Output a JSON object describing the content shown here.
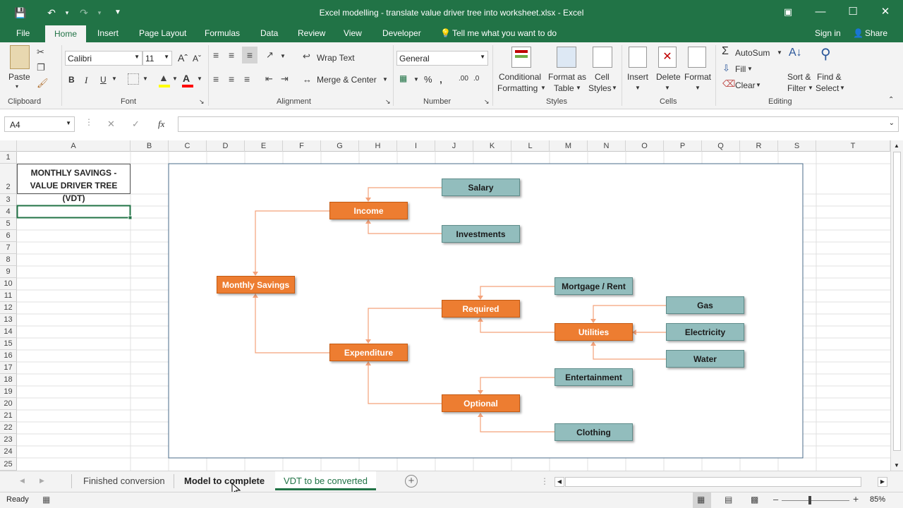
{
  "window": {
    "title": "Excel modelling - translate value driver tree into worksheet.xlsx - Excel",
    "restore_icon": "restore-window-icon"
  },
  "tabs": [
    {
      "label": "File"
    },
    {
      "label": "Home"
    },
    {
      "label": "Insert"
    },
    {
      "label": "Page Layout"
    },
    {
      "label": "Formulas"
    },
    {
      "label": "Data"
    },
    {
      "label": "Review"
    },
    {
      "label": "View"
    },
    {
      "label": "Developer"
    }
  ],
  "tell_me": "Tell me what you want to do",
  "sign_in": "Sign in",
  "share": "Share",
  "ribbon": {
    "clipboard": {
      "paste": "Paste",
      "label": "Clipboard"
    },
    "font": {
      "name": "Calibri",
      "size": "11",
      "label": "Font",
      "bold": "B",
      "italic": "I",
      "underline": "U"
    },
    "alignment": {
      "wrap": "Wrap Text",
      "merge": "Merge & Center",
      "label": "Alignment"
    },
    "number": {
      "format": "General",
      "label": "Number",
      "percent": "%"
    },
    "styles": {
      "conditional1": "Conditional",
      "conditional2": "Formatting",
      "format_as1": "Format as",
      "format_as2": "Table",
      "cell1": "Cell",
      "cell2": "Styles",
      "label": "Styles"
    },
    "cells": {
      "insert": "Insert",
      "delete": "Delete",
      "format": "Format",
      "label": "Cells"
    },
    "editing": {
      "autosum": "AutoSum",
      "fill": "Fill",
      "clear": "Clear",
      "sort1": "Sort &",
      "sort2": "Filter",
      "find1": "Find &",
      "find2": "Select",
      "label": "Editing"
    }
  },
  "formula_bar": {
    "name_box": "A4",
    "fx": "fx",
    "value": ""
  },
  "columns": [
    "A",
    "B",
    "C",
    "D",
    "E",
    "F",
    "G",
    "H",
    "I",
    "J",
    "K",
    "L",
    "M",
    "N",
    "O",
    "P",
    "Q",
    "R",
    "S",
    "T"
  ],
  "rows": [
    "1",
    "2",
    "3",
    "4",
    "5",
    "6",
    "7",
    "8",
    "9",
    "10",
    "11",
    "12",
    "13",
    "14",
    "15",
    "16",
    "17",
    "18",
    "19",
    "20",
    "21",
    "22",
    "23",
    "24",
    "25"
  ],
  "cells": {
    "a2_line1": "MONTHLY SAVINGS -",
    "a2_line2": "VALUE DRIVER TREE (VDT)"
  },
  "vdt": {
    "salary": "Salary",
    "income": "Income",
    "investments": "Investments",
    "monthly_savings": "Monthly Savings",
    "mortgage": "Mortgage / Rent",
    "required": "Required",
    "gas": "Gas",
    "utilities": "Utilities",
    "electricity": "Electricity",
    "water": "Water",
    "expenditure": "Expenditure",
    "entertainment": "Entertainment",
    "optional": "Optional",
    "clothing": "Clothing",
    "colors": {
      "orange": "#ED7D31",
      "teal": "#92BDBD",
      "connector": "#F4A27A"
    }
  },
  "sheets": [
    {
      "label": "Finished conversion"
    },
    {
      "label": "Model to complete"
    },
    {
      "label": "VDT to be converted"
    }
  ],
  "status": {
    "ready": "Ready",
    "zoom": "85%"
  }
}
